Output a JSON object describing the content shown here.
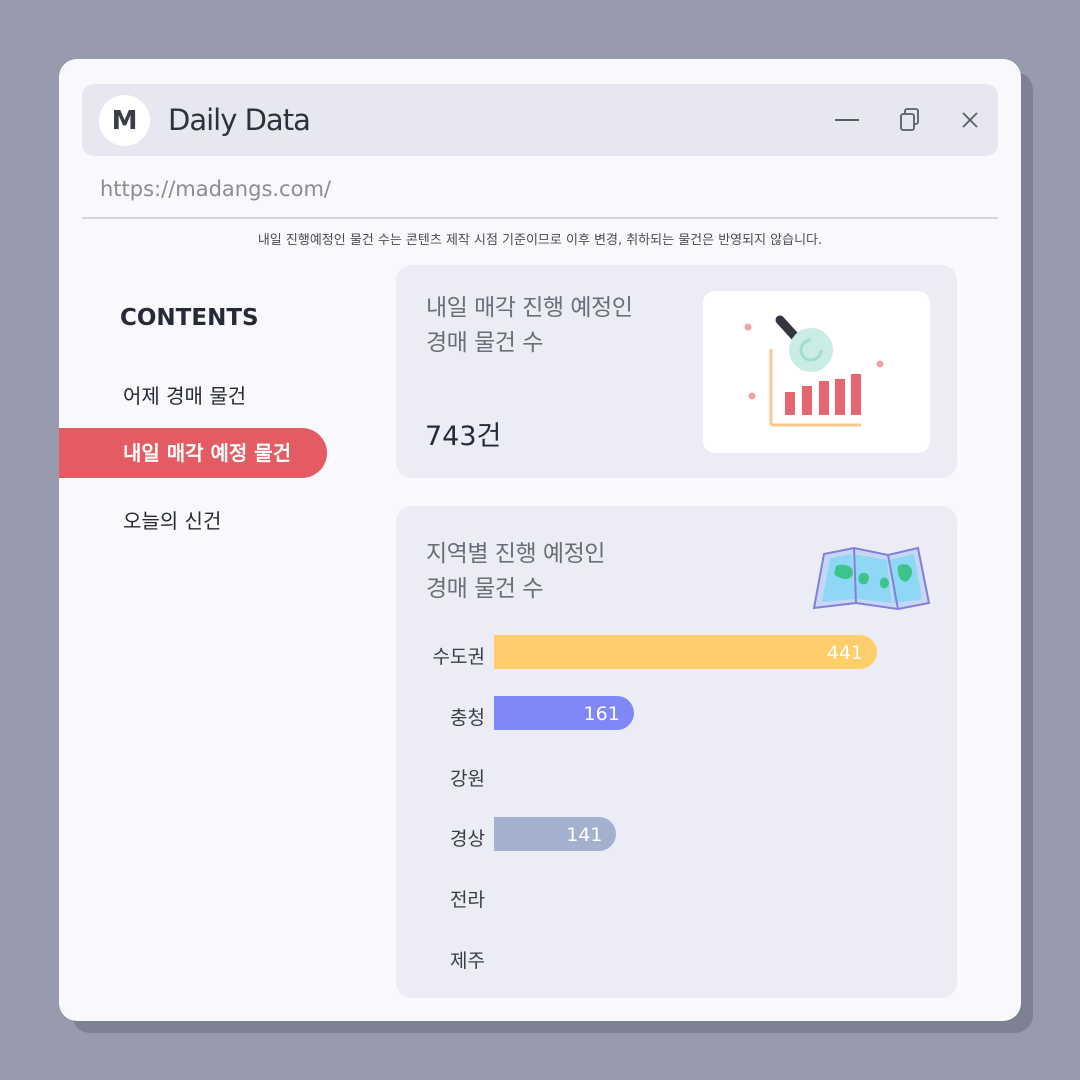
{
  "app": {
    "logo_letter": "M",
    "title": "Daily Data",
    "url": "https://madangs.com/"
  },
  "notice": "내일 진행예정인 물건 수는 콘텐츠 제작 시점 기준이므로 이후 변경, 취하되는 물건은 반영되지 않습니다.",
  "sidebar": {
    "title": "CONTENTS",
    "items": [
      {
        "label": "어제 경매 물건",
        "active": false
      },
      {
        "label": "내일 매각 예정 물건",
        "active": true
      },
      {
        "label": "오늘의 신건",
        "active": false
      }
    ]
  },
  "summary": {
    "title_line1": "내일 매각 진행 예정인",
    "title_line2": "경매 물건 수",
    "count": "743건"
  },
  "regional": {
    "title_line1": "지역별 진행 예정인",
    "title_line2": "경매 물건 수"
  },
  "chart_data": {
    "type": "bar",
    "orientation": "horizontal",
    "categories": [
      "수도권",
      "충청",
      "강원",
      "경상",
      "전라",
      "제주"
    ],
    "values": [
      441,
      161,
      0,
      141,
      0,
      0
    ],
    "value_labels": [
      "441",
      "161",
      "",
      "141",
      "",
      ""
    ],
    "colors": [
      "#ffcd69",
      "#7f88f6",
      "#a9b0d6",
      "#a3b1cf",
      "#a9b0d6",
      "#a9b0d6"
    ],
    "xlim": [
      0,
      441
    ]
  },
  "colors": {
    "accent": "#e45b63",
    "background": "#989aad",
    "window": "#f8f8fd",
    "card": "#ebecf5"
  },
  "icons": {
    "minimize": "minimize-icon",
    "restore": "restore-icon",
    "close": "close-icon",
    "analytics": "magnifier-chart-illustration",
    "map": "folded-map-icon"
  }
}
